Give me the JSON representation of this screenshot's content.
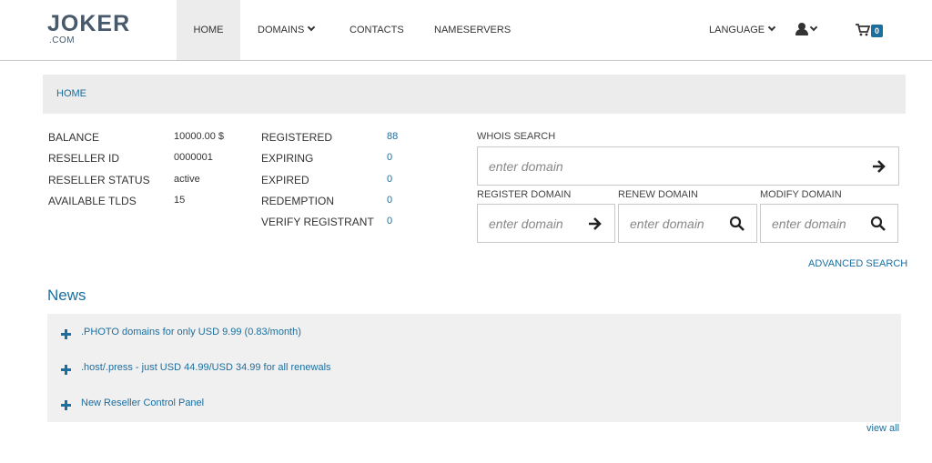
{
  "logo": {
    "main": "JOKER",
    "sub": ".COM"
  },
  "nav": {
    "home": "HOME",
    "domains": "DOMAINS",
    "contacts": "CONTACTS",
    "nameservers": "NAMESERVERS",
    "language": "LANGUAGE",
    "cart_count": "0"
  },
  "breadcrumb": {
    "home": "HOME"
  },
  "account": {
    "balance_label": "BALANCE",
    "balance_value": "10000.00 $",
    "reseller_id_label": "RESELLER ID",
    "reseller_id_value": "0000001",
    "reseller_status_label": "RESELLER STATUS",
    "reseller_status_value": "active",
    "available_tlds_label": "AVAILABLE TLDS",
    "available_tlds_value": "15"
  },
  "domain_stats": {
    "registered_label": "REGISTERED",
    "registered_value": "88",
    "expiring_label": "EXPIRING",
    "expiring_value": "0",
    "expired_label": "EXPIRED",
    "expired_value": "0",
    "redemption_label": "REDEMPTION",
    "redemption_value": "0",
    "verify_label": "VERIFY REGISTRANT",
    "verify_value": "0"
  },
  "search": {
    "whois_label": "WHOIS SEARCH",
    "register_label": "REGISTER DOMAIN",
    "renew_label": "RENEW DOMAIN",
    "modify_label": "MODIFY DOMAIN",
    "placeholder": "enter domain",
    "advanced": "ADVANCED SEARCH"
  },
  "news": {
    "title": "News",
    "items": [
      ".PHOTO domains for only USD 9.99 (0.83/month)",
      ".host/.press - just USD 44.99/USD 34.99 for all renewals",
      "New Reseller Control Panel"
    ],
    "view_all": "view all"
  },
  "colors": {
    "accent": "#1c6e9e",
    "panel": "#ececec",
    "logo": "#47596b"
  },
  "icons": [
    "user-icon",
    "cart-icon",
    "arrow-right-icon",
    "search-icon",
    "plus-icon",
    "chevron-down-icon"
  ]
}
